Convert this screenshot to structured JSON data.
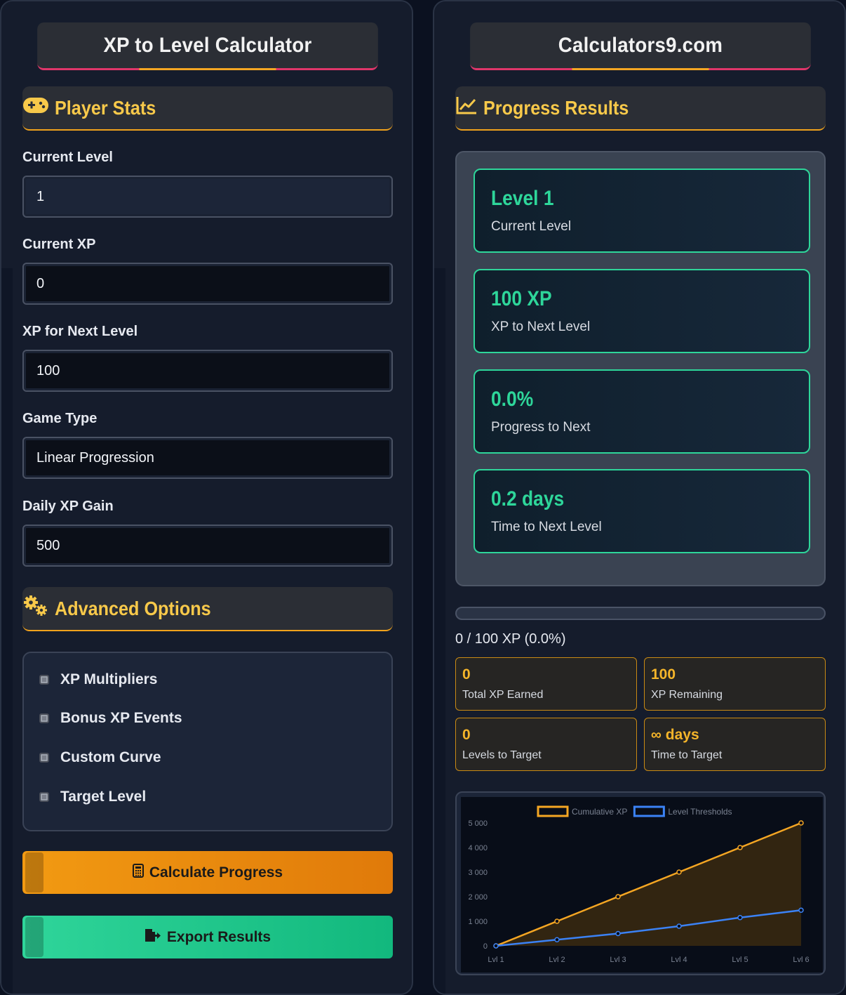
{
  "left": {
    "title": "XP to Level Calculator",
    "player_stats": {
      "heading": "Player Stats",
      "icon": "gamepad-icon",
      "fields": [
        {
          "label": "Current Level",
          "value": "1"
        },
        {
          "label": "Current XP",
          "value": "0"
        },
        {
          "label": "XP for Next Level",
          "value": "100"
        },
        {
          "label": "Game Type",
          "value": "Linear Progression"
        },
        {
          "label": "Daily XP Gain",
          "value": "500"
        }
      ]
    },
    "advanced": {
      "heading": "Advanced Options",
      "icon": "gears-icon",
      "options": [
        "XP Multipliers",
        "Bonus XP Events",
        "Custom Curve",
        "Target Level"
      ]
    },
    "buttons": {
      "calculate": "Calculate Progress",
      "export": "Export Results"
    }
  },
  "right": {
    "title": "Calculators9.com",
    "results": {
      "heading": "Progress Results",
      "icon": "chart-line-icon",
      "cards": [
        {
          "value": "Level 1",
          "label": "Current Level"
        },
        {
          "value": "100 XP",
          "label": "XP to Next Level"
        },
        {
          "value": "0.0%",
          "label": "Progress to Next"
        },
        {
          "value": "0.2 days",
          "label": "Time to Next Level"
        }
      ]
    },
    "progress": {
      "percent": 0,
      "text": "0 / 100 XP (0.0%)"
    },
    "stats": [
      {
        "value": "0",
        "label": "Total XP Earned"
      },
      {
        "value": "100",
        "label": "XP Remaining"
      },
      {
        "value": "0",
        "label": "Levels to Target"
      },
      {
        "value": "∞ days",
        "label": "Time to Target"
      }
    ]
  },
  "colors": {
    "accent_green": "#2ed69a",
    "accent_gold": "#f8c94a",
    "accent_orange": "#f29a12",
    "accent_pink": "#e0366a"
  },
  "chart_data": {
    "type": "line",
    "categories": [
      "Lvl 1",
      "Lvl 2",
      "Lvl 3",
      "Lvl 4",
      "Lvl 5",
      "Lvl 6"
    ],
    "series": [
      {
        "name": "Cumulative XP",
        "values": [
          0,
          1000,
          2000,
          3000,
          4000,
          5000
        ],
        "color": "#f5a623",
        "fill": true
      },
      {
        "name": "Level Thresholds",
        "values": [
          0,
          250,
          500,
          800,
          1150,
          1450
        ],
        "color": "#3b82f6",
        "fill": false
      }
    ],
    "yticks": [
      "0",
      "1 000",
      "2 000",
      "3 000",
      "4 000",
      "5 000"
    ],
    "ylim": [
      0,
      5000
    ],
    "legend_position": "top"
  }
}
